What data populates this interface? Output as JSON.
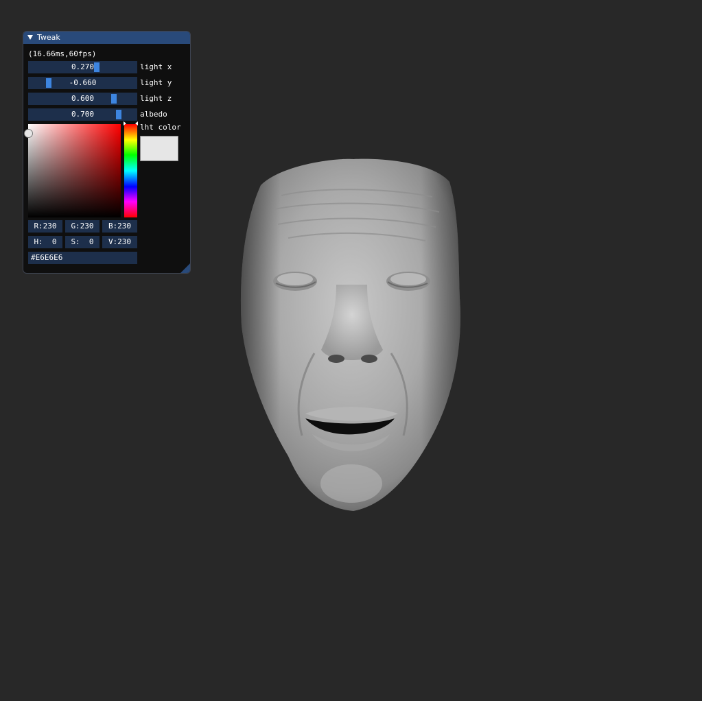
{
  "panel": {
    "title": "Tweak",
    "stats": "(16.66ms,60fps)",
    "sliders": [
      {
        "value": "0.270",
        "label": "light x",
        "fraction": 0.635
      },
      {
        "value": "-0.660",
        "label": "light y",
        "fraction": 0.17
      },
      {
        "value": "0.600",
        "label": "light z",
        "fraction": 0.8
      },
      {
        "value": "0.700",
        "label": "albedo",
        "fraction": 0.85
      }
    ],
    "color_picker": {
      "label": "lht color",
      "swatch_color": "#E6E6E6",
      "channels_rgb": [
        "R:230",
        "G:230",
        "B:230"
      ],
      "channels_hsv": [
        "H:  0",
        "S:  0",
        "V:230"
      ],
      "hex": "#E6E6E6"
    }
  },
  "viewport": {
    "background": "#282828",
    "model": "face-mesh"
  },
  "colors": {
    "title_bar": "#294a7a",
    "frame_bg": "#1d2f4b",
    "slider_grab": "#3d85e0",
    "panel_bg": "#0f0f0f"
  }
}
